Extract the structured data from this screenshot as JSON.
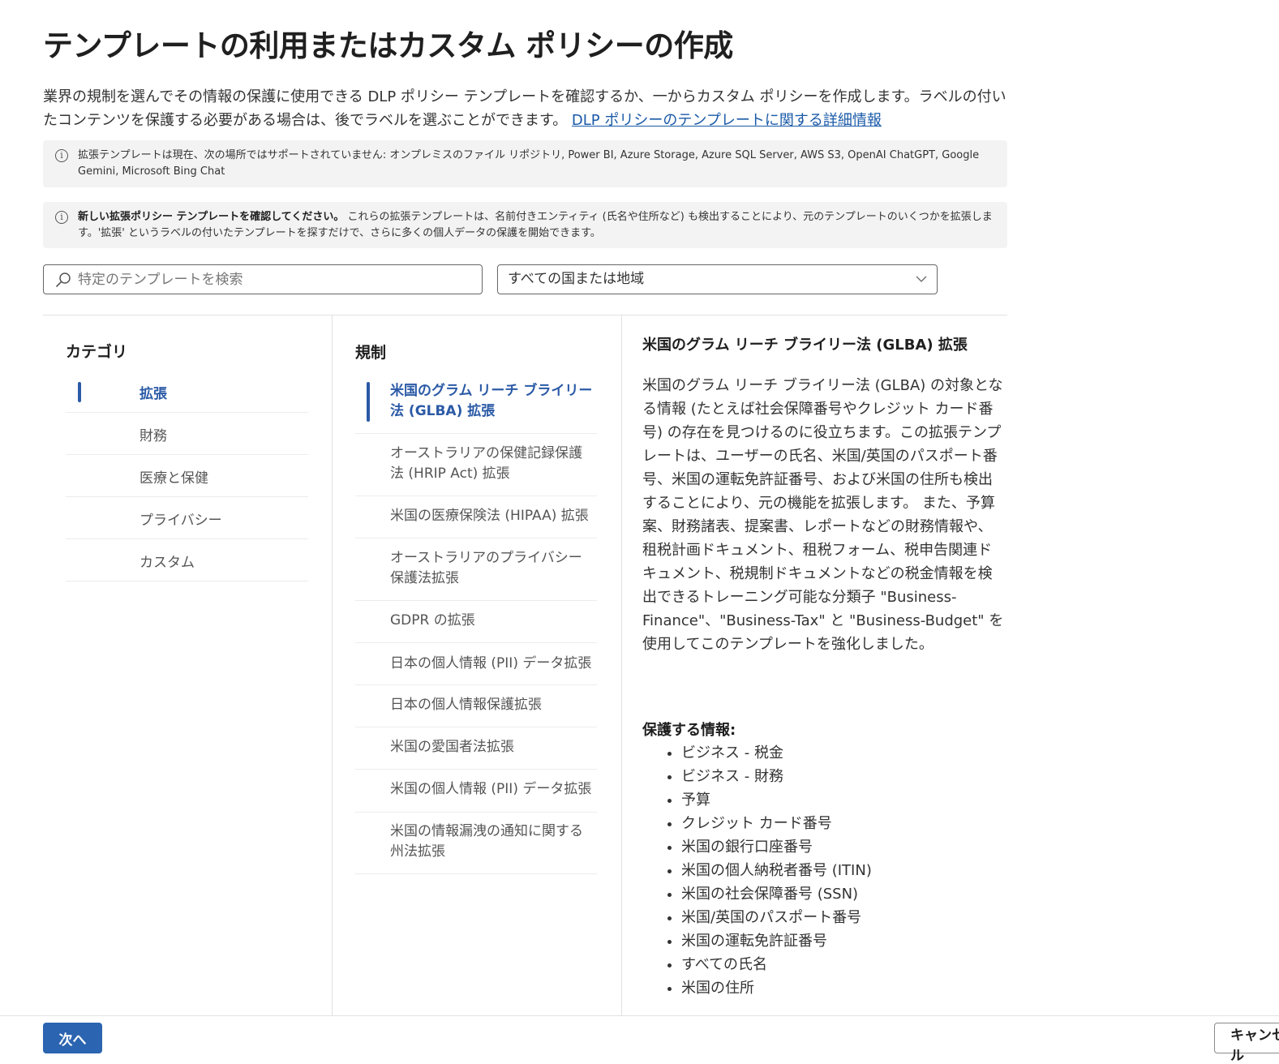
{
  "page_title": "テンプレートの利用またはカスタム ポリシーの作成",
  "intro": {
    "text": "業界の規制を選んでその情報の保護に使用できる DLP ポリシー テンプレートを確認するか、一からカスタム ポリシーを作成します。ラベルの付いたコンテンツを保護する必要がある場合は、後でラベルを選ぶことができます。 ",
    "link": "DLP ポリシーのテンプレートに関する詳細情報"
  },
  "notices": [
    {
      "bold": "",
      "text": "拡張テンプレートは現在、次の場所ではサポートされていません: オンプレミスのファイル リポジトリ, Power BI, Azure Storage, Azure SQL Server, AWS S3, OpenAI ChatGPT, Google Gemini, Microsoft Bing Chat"
    },
    {
      "bold": "新しい拡張ポリシー テンプレートを確認してください。",
      "text": " これらの拡張テンプレートは、名前付きエンティティ (氏名や住所など) も検出することにより、元のテンプレートのいくつかを拡張します。'拡張' というラベルの付いたテンプレートを探すだけで、さらに多くの個人データの保護を開始できます。"
    }
  ],
  "search": {
    "placeholder": "特定のテンプレートを検索"
  },
  "region_dropdown": {
    "value": "すべての国または地域"
  },
  "categories": {
    "header": "カテゴリ",
    "items": [
      "拡張",
      "財務",
      "医療と保健",
      "プライバシー",
      "カスタム"
    ],
    "selected": "拡張"
  },
  "regulations": {
    "header": "規制",
    "items": [
      "米国のグラム リーチ ブライリー法 (GLBA) 拡張",
      "オーストラリアの保健記録保護法 (HRIP Act) 拡張",
      "米国の医療保険法 (HIPAA) 拡張",
      "オーストラリアのプライバシー保護法拡張",
      "GDPR の拡張",
      "日本の個人情報 (PII) データ拡張",
      "日本の個人情報保護拡張",
      "米国の愛国者法拡張",
      "米国の個人情報 (PII) データ拡張",
      "米国の情報漏洩の通知に関する州法拡張"
    ],
    "selected": "米国のグラム リーチ ブライリー法 (GLBA) 拡張"
  },
  "detail": {
    "title": "米国のグラム リーチ ブライリー法 (GLBA) 拡張",
    "description": "米国のグラム リーチ ブライリー法 (GLBA) の対象となる情報 (たとえば社会保障番号やクレジット カード番号) の存在を見つけるのに役立ちます。この拡張テンプレートは、ユーザーの氏名、米国/英国のパスポート番号、米国の運転免許証番号、および米国の住所も検出することにより、元の機能を拡張します。 また、予算案、財務諸表、提案書、レポートなどの財務情報や、租税計画ドキュメント、租税フォーム、税申告関連ドキュメント、税規制ドキュメントなどの税金情報を検出できるトレーニング可能な分類子 \"Business-Finance\"、\"Business-Tax\" と \"Business-Budget\" を使用してこのテンプレートを強化しました。",
    "protect_header": "保護する情報:",
    "protect_items": [
      "ビジネス - 税金",
      "ビジネス - 財務",
      "予算",
      "クレジット カード番号",
      "米国の銀行口座番号",
      "米国の個人納税者番号 (ITIN)",
      "米国の社会保障番号 (SSN)",
      "米国/英国のパスポート番号",
      "米国の運転免許証番号",
      "すべての氏名",
      "米国の住所"
    ]
  },
  "footer": {
    "next_label": "次へ",
    "cancel_label": "キャンセル"
  }
}
